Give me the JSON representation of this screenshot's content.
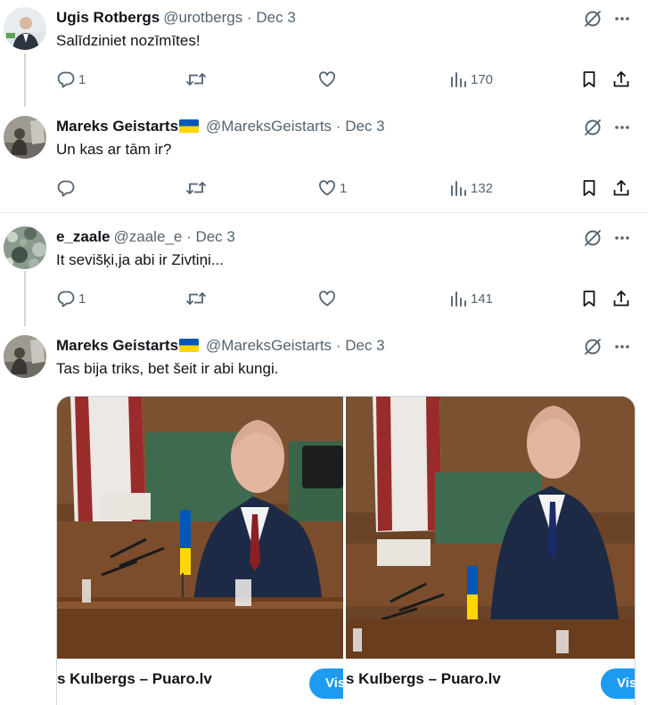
{
  "tweets": [
    {
      "name": "Ugis Rotbergs",
      "handle": "@urotbergs",
      "separator": "·",
      "date": "Dec 3",
      "text": "Salīdziniet nozīmītes!",
      "replies": "1",
      "retweets": "",
      "likes": "",
      "views": "170",
      "flag": false
    },
    {
      "name": "Mareks Geistarts",
      "handle": "@MareksGeistarts",
      "separator": "·",
      "date": "Dec 3",
      "text": "Un kas ar tām ir?",
      "replies": "",
      "retweets": "",
      "likes": "1",
      "views": "132",
      "flag": true
    },
    {
      "name": "e_zaale",
      "handle": "@zaale_e",
      "separator": "·",
      "date": "Dec 3",
      "text": "It sevišķi,ja abi ir Zivtiņi...",
      "replies": "1",
      "retweets": "",
      "likes": "",
      "views": "141",
      "flag": false
    },
    {
      "name": "Mareks Geistarts",
      "handle": "@MareksGeistarts",
      "separator": "·",
      "date": "Dec 3",
      "text": "Tas bija triks, bet šeit ir abi kungi.",
      "flag": true
    }
  ],
  "media_cards": [
    {
      "caption": "s Kulbergs – Puaro.lv",
      "button": "Visit"
    },
    {
      "caption": "s Kulbergs – Puaro.lv",
      "button": "Visit"
    }
  ],
  "icons": {
    "reply": "reply-icon",
    "retweet": "retweet-icon",
    "like": "heart-icon",
    "views": "views-icon",
    "bookmark": "bookmark-icon",
    "share": "share-icon",
    "grok": "grok-icon",
    "more": "more-icon"
  },
  "colors": {
    "text": "#0f1419",
    "secondary": "#536471",
    "accent": "#1d9bf0",
    "divider": "#eff3f4",
    "thread_line": "#cfd9de"
  }
}
